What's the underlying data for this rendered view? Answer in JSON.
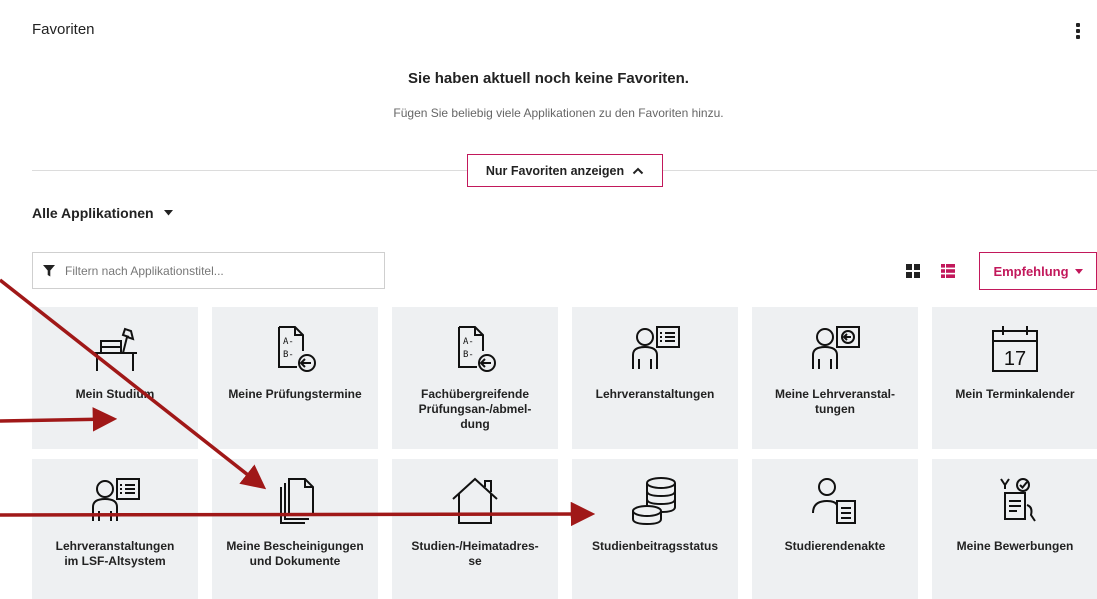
{
  "favorites": {
    "header": "Favoriten",
    "empty_title": "Sie haben aktuell noch keine Favoriten.",
    "empty_subtitle": "Fügen Sie beliebig viele Applikationen zu den Favoriten hinzu.",
    "toggle_label": "Nur Favoriten anzeigen"
  },
  "all_apps": {
    "heading": "Alle Applikationen",
    "filter_placeholder": "Filtern nach Applikationstitel...",
    "sort_label": "Empfehlung"
  },
  "tiles": [
    {
      "label": "Mein Studium",
      "icon": "desk-lamp-icon"
    },
    {
      "label": "Meine Prüfungstermine",
      "icon": "exam-sheet-icon"
    },
    {
      "label": "Fachübergreifende\nPrüfungsan-/abmel-\ndung",
      "icon": "exam-sheet-icon"
    },
    {
      "label": "Lehrveranstaltungen",
      "icon": "lecturer-icon"
    },
    {
      "label": "Meine Lehrveranstal-\ntungen",
      "icon": "lecturer-board-icon"
    },
    {
      "label": "Mein Terminkalender",
      "icon": "calendar-icon",
      "calendar_day": "17"
    },
    {
      "label": "Lehrveranstaltungen\nim LSF-Altsystem",
      "icon": "lecturer-icon"
    },
    {
      "label": "Meine Bescheinigungen\nund Dokumente",
      "icon": "documents-icon"
    },
    {
      "label": "Studien-/Heimatadres-\nse",
      "icon": "house-icon"
    },
    {
      "label": "Studienbeitragsstatus",
      "icon": "coins-icon"
    },
    {
      "label": "Studierendenakte",
      "icon": "student-file-icon"
    },
    {
      "label": "Meine Bewerbungen",
      "icon": "application-icon"
    }
  ],
  "colors": {
    "accent": "#c2185b",
    "annotation_arrow": "#a01818",
    "tile_bg": "#eef0f2"
  }
}
